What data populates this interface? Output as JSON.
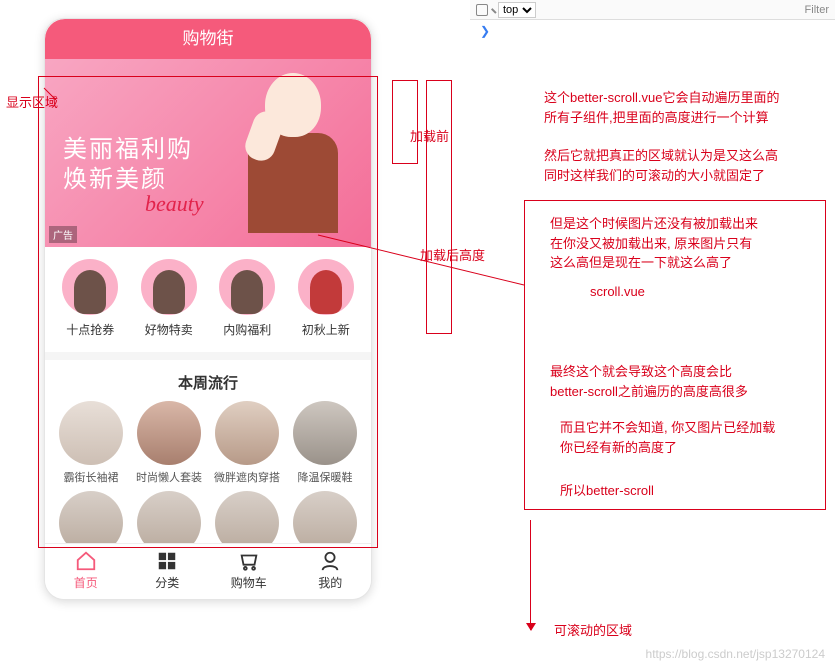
{
  "devtools": {
    "top_select": "top",
    "filter_placeholder": "Filter"
  },
  "phone": {
    "header_title": "购物街",
    "banner": {
      "line1": "美丽福利购",
      "line2": "焕新美颜",
      "script": "beauty",
      "ad_tag": "广告"
    },
    "categories": [
      {
        "label": "十点抢券"
      },
      {
        "label": "好物特卖"
      },
      {
        "label": "内购福利"
      },
      {
        "label": "初秋上新"
      }
    ],
    "section_title": "本周流行",
    "grid_items": [
      {
        "label": "霸街长袖裙"
      },
      {
        "label": "时尚懒人套装"
      },
      {
        "label": "微胖遮肉穿搭"
      },
      {
        "label": "降温保暖鞋"
      },
      {
        "label": ""
      },
      {
        "label": ""
      },
      {
        "label": ""
      },
      {
        "label": ""
      }
    ],
    "tabs": [
      {
        "label": "首页"
      },
      {
        "label": "分类"
      },
      {
        "label": "购物车"
      },
      {
        "label": "我的"
      }
    ]
  },
  "annotations": {
    "display_area": "显示区域",
    "before_load": "加载前",
    "after_load_height": "加载后高度",
    "note1_line1": "这个better-scroll.vue它会自动遍历里面的",
    "note1_line2": "所有子组件,把里面的高度进行一个计算",
    "note2_line1": "然后它就把真正的区域就认为是又这么高",
    "note2_line2": "同时这样我们的可滚动的大小就固定了",
    "note3_line1": "但是这个时候图片还没有被加载出来",
    "note3_line2": "在你没又被加载出来, 原来图片只有",
    "note3_line3": "这么高但是现在一下就这么高了",
    "scroll_vue": "scroll.vue",
    "note4_line1": "最终这个就会导致这个高度会比",
    "note4_line2": "better-scroll之前遍历的高度高很多",
    "note5_line1": "而且它并不会知道, 你又图片已经加载",
    "note5_line2": "你已经有新的高度了",
    "note6": "所以better-scroll",
    "scrollable_area": "可滚动的区域"
  },
  "watermark": "https://blog.csdn.net/jsp13270124"
}
